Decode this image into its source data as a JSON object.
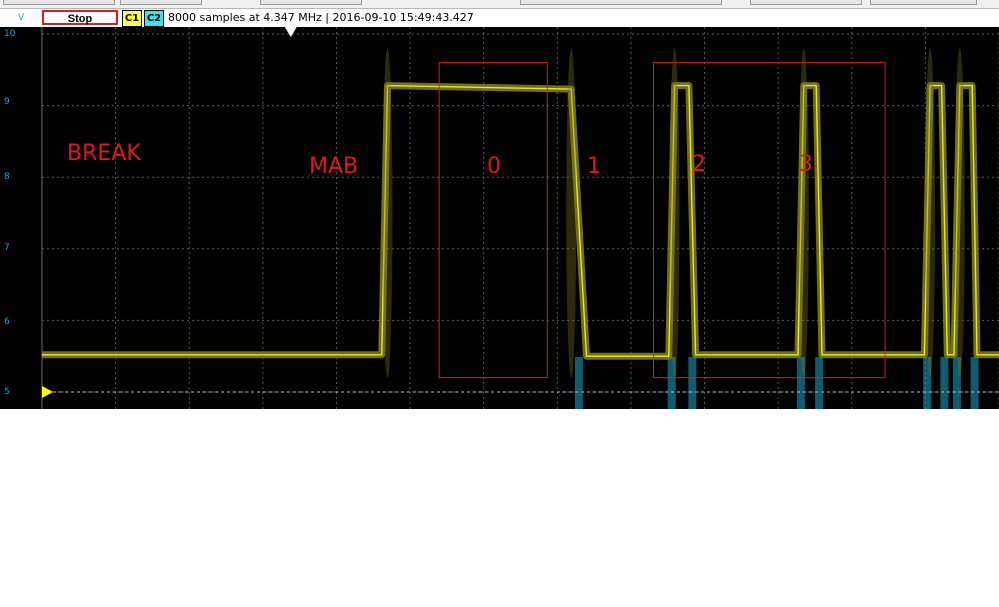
{
  "toolbar": {
    "stop_label": "Stop",
    "channel1_label": "C1",
    "channel2_label": "C2",
    "capture_info": "8000 samples at 4.347 MHz | 2016-09-10 15:49:43.427"
  },
  "colors": {
    "trace": "#e8e820",
    "trace_glow": "#7a7a1e",
    "channel2": "#1aa7c9",
    "annotation": "#e01818",
    "grid": "#5a5a5a",
    "background": "#000000"
  },
  "chart_data": {
    "type": "line",
    "ylabel": "V",
    "ylim": [
      5,
      10
    ],
    "yticks": [
      "10",
      "9",
      "8",
      "7",
      "6",
      "5"
    ],
    "grid": true,
    "series": [
      {
        "x": [
          0,
          0.355,
          0.361,
          0.553,
          0.569,
          0.655,
          0.661,
          0.676,
          0.683,
          0.79,
          0.796,
          0.809,
          0.815,
          0.922,
          0.928,
          0.94,
          0.946,
          0.953,
          0.959,
          0.972,
          0.977,
          1.0
        ],
        "values": [
          5.52,
          5.52,
          9.28,
          9.23,
          5.5,
          5.5,
          9.28,
          9.28,
          5.52,
          5.52,
          9.28,
          9.28,
          5.52,
          5.52,
          9.28,
          9.28,
          5.52,
          5.52,
          9.28,
          9.28,
          5.52,
          5.52
        ]
      }
    ],
    "annotations": [
      "BREAK",
      "MAB",
      "0",
      "1",
      "2",
      "3"
    ]
  }
}
